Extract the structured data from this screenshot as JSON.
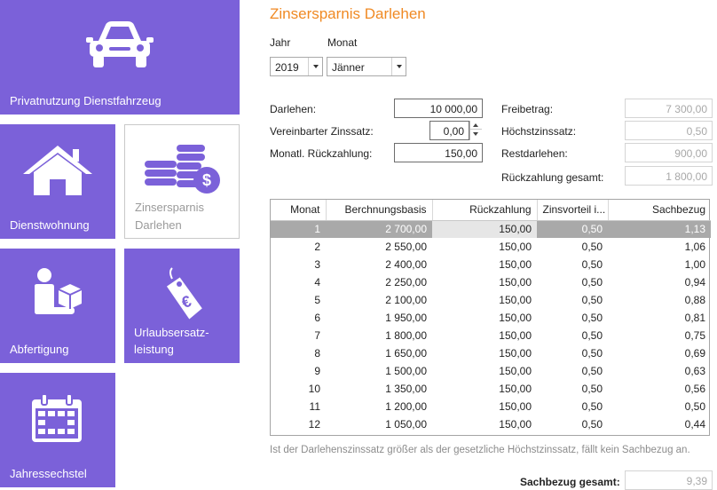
{
  "tiles": {
    "car": "Privatnutzung Dienstfahrzeug",
    "housing": "Dienstwohnung",
    "loan_line1": "Zinsersparnis",
    "loan_line2": "Darlehen",
    "severance": "Abfertigung",
    "vacation_line1": "Urlaubsersatz-",
    "vacation_line2": "leistung",
    "sixth": "Jahressechstel"
  },
  "form": {
    "title": "Zinsersparnis Darlehen",
    "year_label": "Jahr",
    "month_label": "Monat",
    "year_value": "2019",
    "month_value": "Jänner",
    "loan_label": "Darlehen:",
    "loan_value": "10 000,00",
    "rate_label": "Vereinbarter Zinssatz:",
    "rate_value": "0,00",
    "repay_label": "Monatl. Rückzahlung:",
    "repay_value": "150,00",
    "allowance_label": "Freibetrag:",
    "allowance_value": "7 300,00",
    "max_rate_label": "Höchstzinssatz:",
    "max_rate_value": "0,50",
    "rest_label": "Restdarlehen:",
    "rest_value": "900,00",
    "repay_total_label": "Rückzahlung gesamt:",
    "repay_total_value": "1 800,00"
  },
  "table": {
    "headers": [
      "Monat",
      "Berchnungsbasis",
      "Rückzahlung",
      "Zinsvorteil i...",
      "Sachbezug"
    ],
    "rows": [
      [
        "1",
        "2 700,00",
        "150,00",
        "0,50",
        "1,13"
      ],
      [
        "2",
        "2 550,00",
        "150,00",
        "0,50",
        "1,06"
      ],
      [
        "3",
        "2 400,00",
        "150,00",
        "0,50",
        "1,00"
      ],
      [
        "4",
        "2 250,00",
        "150,00",
        "0,50",
        "0,94"
      ],
      [
        "5",
        "2 100,00",
        "150,00",
        "0,50",
        "0,88"
      ],
      [
        "6",
        "1 950,00",
        "150,00",
        "0,50",
        "0,81"
      ],
      [
        "7",
        "1 800,00",
        "150,00",
        "0,50",
        "0,75"
      ],
      [
        "8",
        "1 650,00",
        "150,00",
        "0,50",
        "0,69"
      ],
      [
        "9",
        "1 500,00",
        "150,00",
        "0,50",
        "0,63"
      ],
      [
        "10",
        "1 350,00",
        "150,00",
        "0,50",
        "0,56"
      ],
      [
        "11",
        "1 200,00",
        "150,00",
        "0,50",
        "0,50"
      ],
      [
        "12",
        "1 050,00",
        "150,00",
        "0,50",
        "0,44"
      ]
    ]
  },
  "note": "Ist der Darlehenszinssatz größer als der gesetzliche Höchstzinssatz, fällt kein Sachbezug an.",
  "total": {
    "label": "Sachbezug gesamt:",
    "value": "9,39"
  },
  "colors": {
    "tile": "#7b61d9",
    "title": "#f08a24",
    "selected_row": "#a9a9a9"
  },
  "icons": [
    "car-icon",
    "house-icon",
    "coins-dollar-icon",
    "person-package-icon",
    "euro-tag-icon",
    "calendar-icon"
  ]
}
